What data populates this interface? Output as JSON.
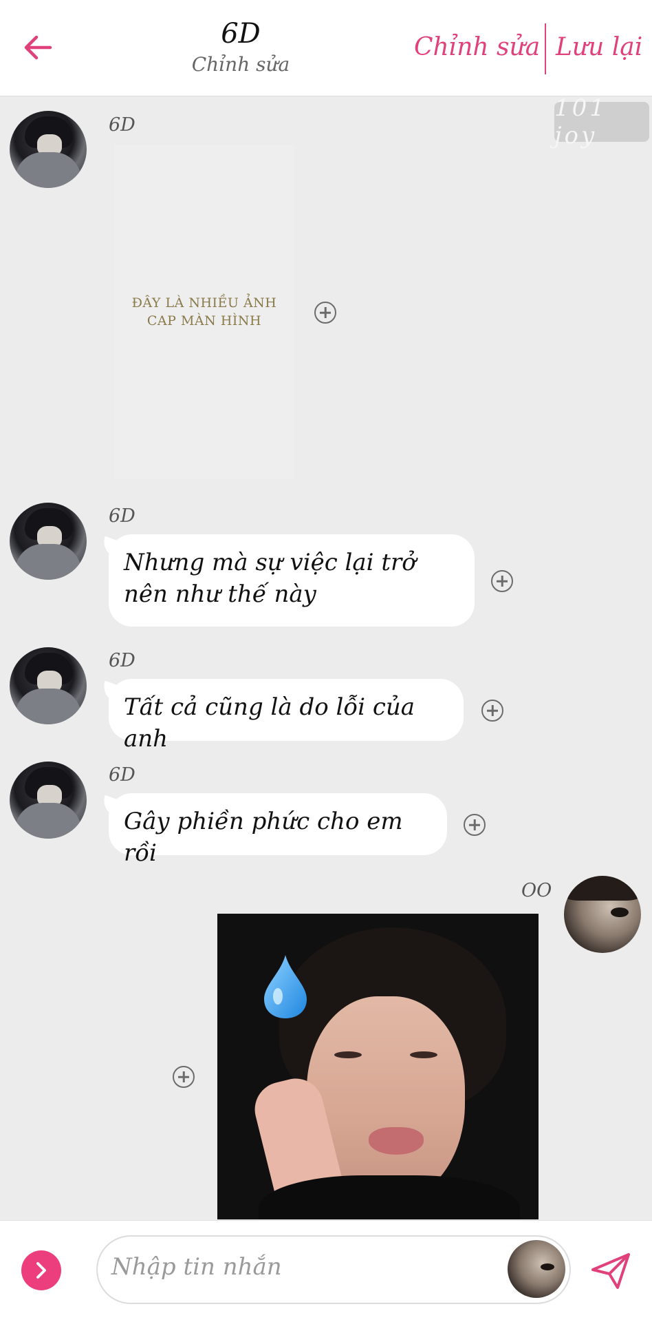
{
  "header": {
    "title": "6D",
    "subtitle": "Chỉnh sửa",
    "edit_label": "Chỉnh sửa",
    "save_label": "Lưu lại",
    "back_icon": "arrow-left-icon"
  },
  "watermark": "101 joy",
  "messages": [
    {
      "sender": "6D",
      "type": "image",
      "image_caption": "ĐÂY LÀ NHIỀU ẢNH\nCAP MÀN HÌNH"
    },
    {
      "sender": "6D",
      "type": "text",
      "text": "Nhưng mà sự việc lại trở nên như thế này"
    },
    {
      "sender": "6D",
      "type": "text",
      "text": "Tất cả cũng là do lỗi của anh"
    },
    {
      "sender": "6D",
      "type": "text",
      "text": "Gây phiền phức cho em rồi"
    },
    {
      "sender": "OO",
      "type": "image"
    }
  ],
  "composer": {
    "placeholder": "Nhập tin nhắn",
    "more_icon": "chevron-right-icon",
    "send_icon": "send-icon"
  },
  "colors": {
    "accent": "#e0417a",
    "background": "#ececec",
    "bubble": "#ffffff"
  }
}
